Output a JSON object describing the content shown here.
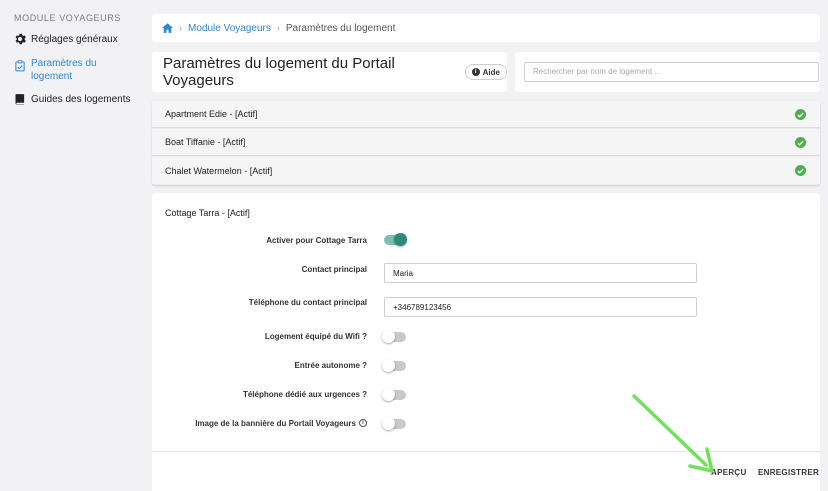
{
  "sidebar": {
    "section": "MODULE VOYAGEURS",
    "items": [
      {
        "label": "Réglages généraux",
        "icon": "gear-icon"
      },
      {
        "label": "Paramètres du logement",
        "label_line1": "Paramètres du",
        "label_line2": "logement",
        "icon": "clipboard-check-icon",
        "active": true
      },
      {
        "label": "Guides des logements",
        "icon": "book-icon"
      }
    ]
  },
  "breadcrumb": {
    "home_icon": "home-icon",
    "module": "Module Voyageurs",
    "current": "Paramètres du logement"
  },
  "header": {
    "title": "Paramètres du logement du Portail Voyageurs",
    "help_label": "Aide"
  },
  "search": {
    "placeholder": "Rechercher par nom de logement ...",
    "value": ""
  },
  "listings": [
    {
      "label": "Apartment Edie - [Actif]",
      "status": "check-icon"
    },
    {
      "label": "Boat Tiffanie - [Actif]",
      "status": "check-icon"
    },
    {
      "label": "Chalet Watermelon - [Actif]",
      "status": "check-icon"
    }
  ],
  "expanded": {
    "title": "Cottage Tarra - [Actif]",
    "fields": {
      "activate_label": "Activer pour Cottage Tarra",
      "activate_on": true,
      "contact_label": "Contact principal",
      "contact_value": "Maria",
      "phone_label": "Téléphone du contact principal",
      "phone_value": "+346789123456",
      "wifi_label": "Logement équipé du Wifi ?",
      "wifi_on": false,
      "self_checkin_label": "Entrée autonome ?",
      "self_checkin_on": false,
      "emergency_label": "Téléphone dédié aux urgences ?",
      "emergency_on": false,
      "banner_label": "Image de la bannière du Portail Voyageurs",
      "banner_on": false
    },
    "preview_label": "APERÇU",
    "save_label": "ENREGISTRER"
  },
  "colors": {
    "accent": "#2d86d6",
    "toggle_on": "#2d8a7a",
    "check": "#4caf50",
    "arrow": "#6ee35a"
  }
}
